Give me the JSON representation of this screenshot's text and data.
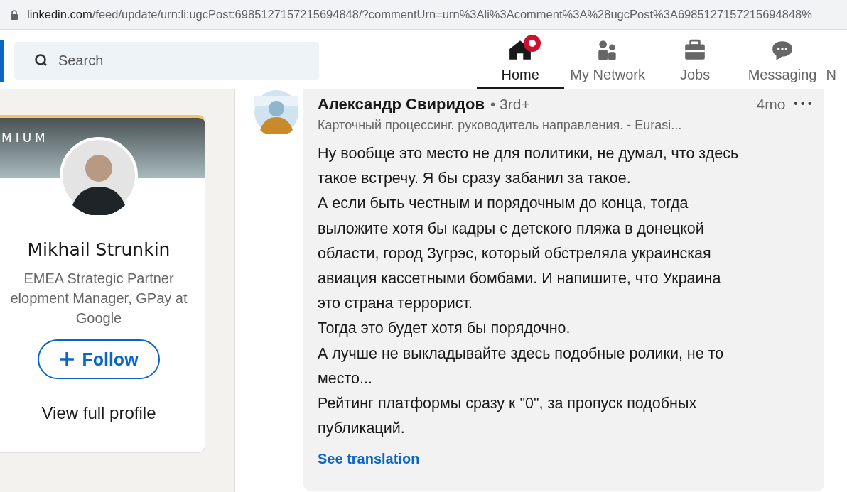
{
  "address_bar": {
    "url_host": "linkedin.com",
    "url_path": "/feed/update/urn:li:ugcPost:6985127157215694848/?commentUrn=urn%3Ali%3Acomment%3A%28ugcPost%3A6985127157215694848%"
  },
  "search": {
    "placeholder": "Search"
  },
  "nav": [
    {
      "label": "Home",
      "kind": "home",
      "selected": true,
      "notification": true
    },
    {
      "label": "My Network",
      "kind": "network",
      "selected": false,
      "notification": false
    },
    {
      "label": "Jobs",
      "kind": "jobs",
      "selected": false,
      "notification": false
    },
    {
      "label": "Messaging",
      "kind": "messaging",
      "selected": false,
      "notification": false
    },
    {
      "label": "N",
      "kind": "text",
      "selected": false,
      "notification": false
    }
  ],
  "profile_card": {
    "banner_label": "MIUM",
    "name": "Mikhail Strunkin",
    "headline": "EMEA Strategic Partner\nelopment Manager, GPay at\nGoogle",
    "follow": "Follow",
    "view_profile": "View full profile"
  },
  "comment": {
    "author": "Александр Свиридов",
    "degree": "• 3rd+",
    "time": "4mo",
    "more": "•••",
    "author_headline": "Карточный процессинг. руководитель направления. - Eurasi...",
    "text": "Ну вообще это место не для политики, не думал, что здесь\nтакое встречу. Я бы сразу забанил за такое.\nА если быть честным и порядочным до конца, тогда\nвыложите хотя бы кадры с детского пляжа в донецкой\nобласти, город Зугрэс, который обстреляла украинская\nавиация кассетными бомбами. И напишите, что Украина\nэто страна террорист.\nТогда это будет хотя бы порядочно.\nА лучше не выкладывайте здесь подобные ролики, не то\nместо...\nРейтинг платформы сразу к \"0\", за пропуск подобных\nпубликаций.",
    "translate": "See translation"
  }
}
